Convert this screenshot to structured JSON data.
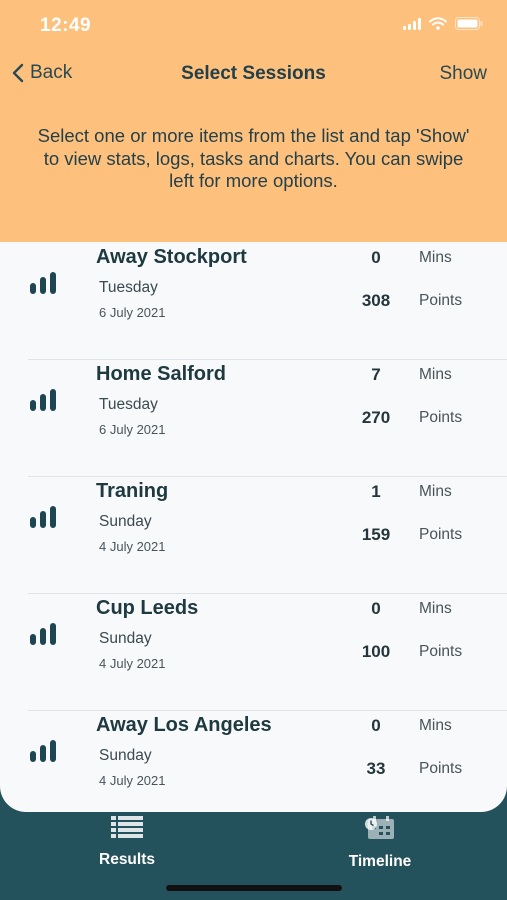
{
  "status_bar": {
    "time": "12:49"
  },
  "nav": {
    "back_label": "Back",
    "title": "Select Sessions",
    "show_label": "Show"
  },
  "instructions": "Select one or more items from the list and tap 'Show' to view stats, logs, tasks and charts. You can swipe left for more options.",
  "sessions": [
    {
      "name": "Away Stockport",
      "day": "Tuesday",
      "date": "6 July 2021",
      "mins": "0",
      "mins_label": "Mins",
      "points": "308",
      "points_label": "Points"
    },
    {
      "name": "Home Salford",
      "day": "Tuesday",
      "date": "6 July 2021",
      "mins": "7",
      "mins_label": "Mins",
      "points": "270",
      "points_label": "Points"
    },
    {
      "name": "Traning",
      "day": "Sunday",
      "date": "4 July 2021",
      "mins": "1",
      "mins_label": "Mins",
      "points": "159",
      "points_label": "Points"
    },
    {
      "name": "Cup Leeds",
      "day": "Sunday",
      "date": "4 July 2021",
      "mins": "0",
      "mins_label": "Mins",
      "points": "100",
      "points_label": "Points"
    },
    {
      "name": "Away Los Angeles",
      "day": "Sunday",
      "date": "4 July 2021",
      "mins": "0",
      "mins_label": "Mins",
      "points": "33",
      "points_label": "Points"
    }
  ],
  "tabs": [
    {
      "label": "Results",
      "icon": "list-icon"
    },
    {
      "label": "Timeline",
      "icon": "calendar-clock-icon"
    }
  ],
  "colors": {
    "header_bg": "#fec07d",
    "tab_bar_bg": "#24525c",
    "icon_color": "#1e4652"
  }
}
